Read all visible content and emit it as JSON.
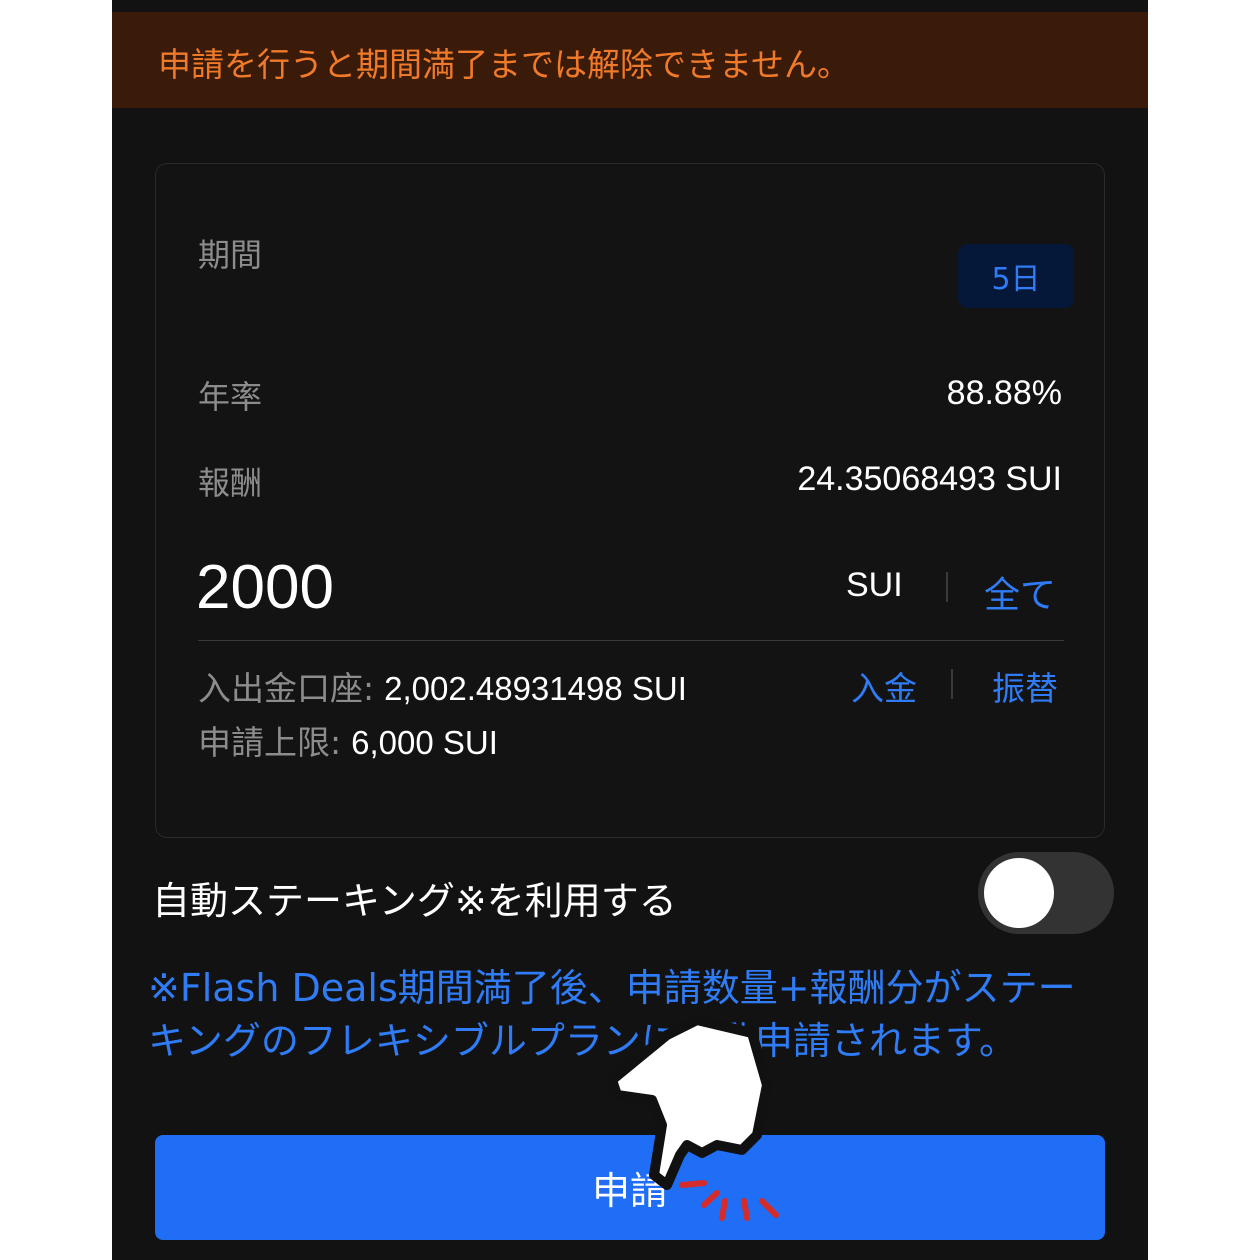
{
  "banner": {
    "warning": "申請を行うと期間満了までは解除できません。"
  },
  "card": {
    "period_label": "期間",
    "period_value": "5日",
    "apr_label": "年率",
    "apr_value": "88.88%",
    "reward_label": "報酬",
    "reward_value": "24.35068493 SUI",
    "amount": "2000",
    "unit": "SUI",
    "max_label": "全て",
    "funding_label": "入出金口座:",
    "funding_value": "2,002.48931498 SUI",
    "deposit_label": "入金",
    "transfer_label": "振替",
    "limit_label": "申請上限:",
    "limit_value": "6,000 SUI"
  },
  "auto_staking": {
    "label": "自動ステーキング※を利用する",
    "enabled": false
  },
  "note": "※Flash Deals期間満了後、申請数量+報酬分がステーキングのフレキシブルプランに自動申請されます。",
  "submit_label": "申請",
  "colors": {
    "accent": "#1f6ef5",
    "warning": "#f07a2a",
    "warning_bg": "#3a1a08"
  }
}
